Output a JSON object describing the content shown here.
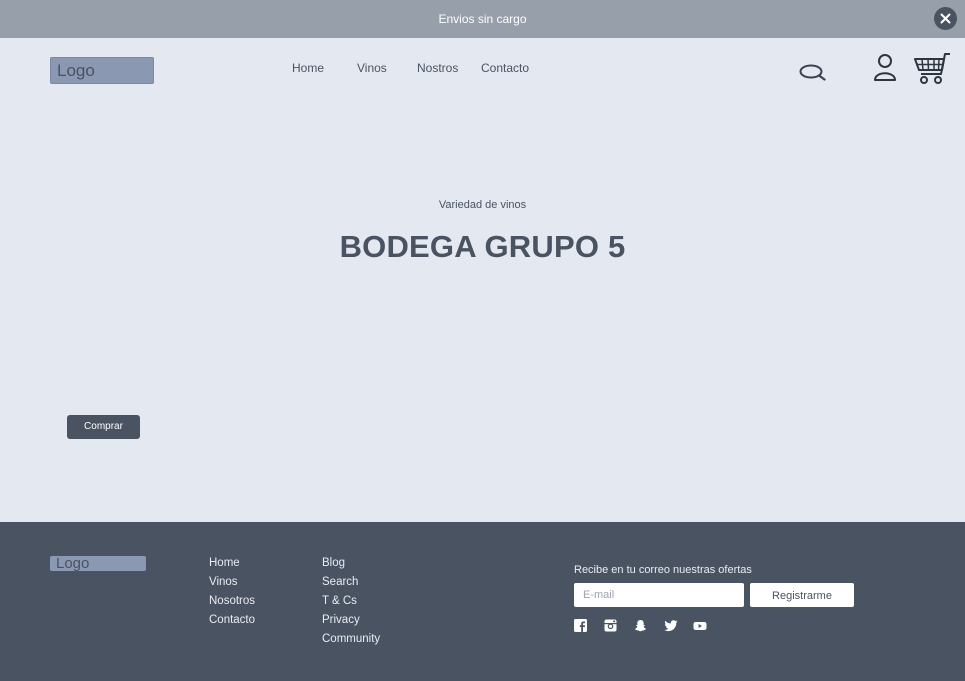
{
  "topbar": {
    "text": "Envios sin cargo"
  },
  "header": {
    "logo": "Logo",
    "nav": [
      "Home",
      "Vinos",
      "Nostros",
      "Contacto"
    ]
  },
  "hero": {
    "subtitle": "Variedad de vinos",
    "title": "BODEGA GRUPO 5",
    "button": "Comprar"
  },
  "footer": {
    "logo": "Logo",
    "col1": [
      "Home",
      "Vinos",
      "Nosotros",
      "Contacto"
    ],
    "col2": [
      "Blog",
      "Search",
      "T & Cs",
      "Privacy",
      "Community"
    ],
    "newsletter_label": "Recibe en tu correo nuestras ofertas",
    "email_placeholder": "E-mail",
    "register_button": "Registrarme",
    "social": [
      "facebook-icon",
      "instagram-icon",
      "snapchat-icon",
      "twitter-icon",
      "youtube-icon"
    ]
  },
  "colors": {
    "topbar": "#979faa",
    "background": "#e4e8f1",
    "dark": "#4a5361",
    "logo": "#8b98b2"
  }
}
